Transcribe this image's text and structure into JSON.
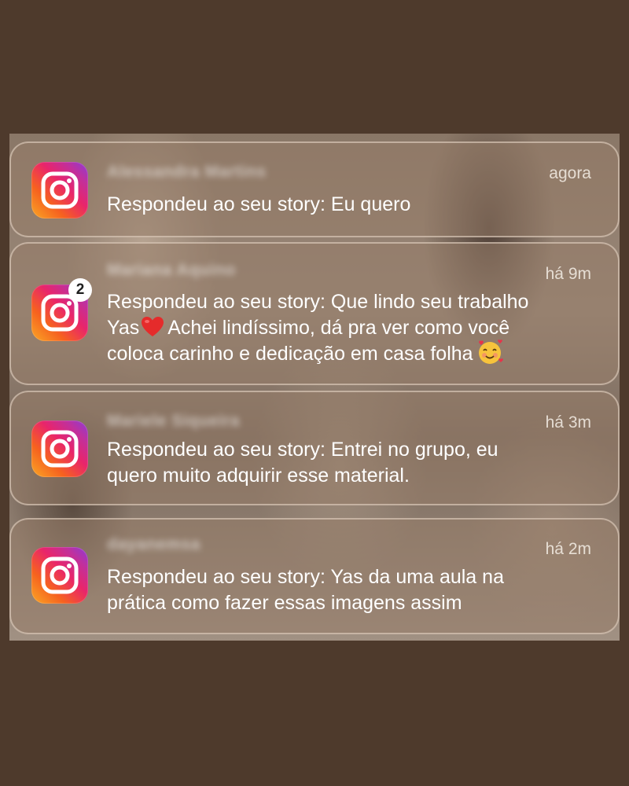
{
  "notifications": [
    {
      "app_icon": "instagram-icon",
      "sender": "Alessandra Martins",
      "time": "agora",
      "message_lines": [
        "Respondeu ao seu story: Eu quero"
      ]
    },
    {
      "app_icon": "instagram-icon",
      "badge": "2",
      "sender": "Mariana Aquino",
      "time": "há 9m",
      "message_lines": [
        "Respondeu ao seu story: Que lindo seu trabalho",
        "Yas",
        "Achei lindíssimo, dá pra ver como você",
        "coloca carinho e dedicação em casa folha"
      ],
      "emojis": [
        "red-heart-emoji",
        "smiling-face-with-hearts-emoji"
      ]
    },
    {
      "app_icon": "instagram-icon",
      "sender": "Mariele Siqueira",
      "time": "há 3m",
      "message_lines": [
        "Respondeu ao seu story: Entrei no grupo, eu",
        "quero muito adquirir esse material."
      ]
    },
    {
      "app_icon": "instagram-icon",
      "sender": "dayanemsa",
      "time": "há 2m",
      "message_lines": [
        "Respondeu ao seu story: Yas da uma aula na",
        "prática como fazer essas imagens assim"
      ]
    }
  ],
  "colors": {
    "page_background": "#4e3a2c",
    "icon_gradient": [
      "#f9a825",
      "#f6621f",
      "#e9256a",
      "#c1309c",
      "#8b3bd6"
    ],
    "text": "#ffffff"
  }
}
